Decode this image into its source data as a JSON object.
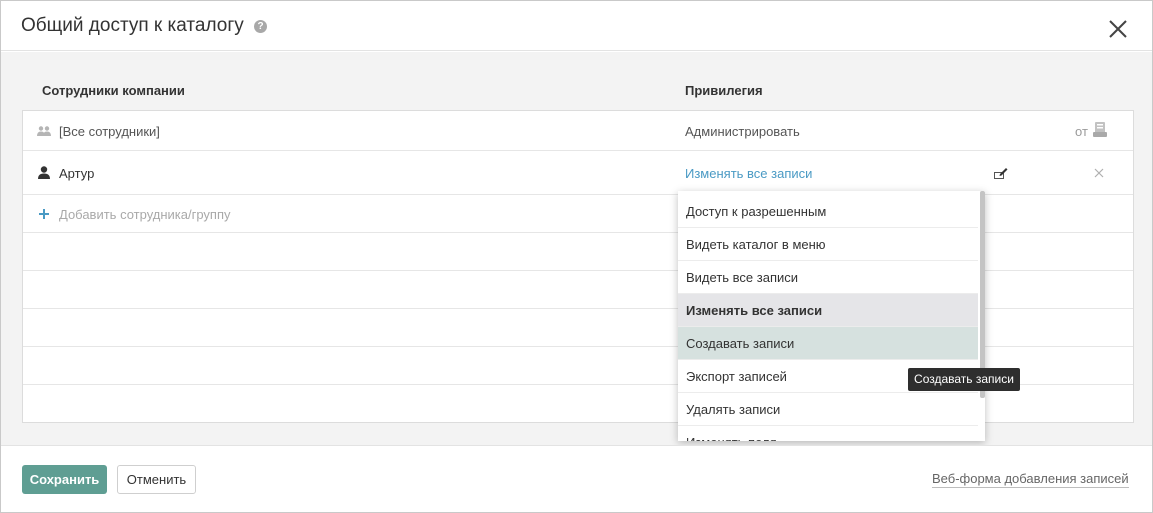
{
  "dialog": {
    "title": "Общий доступ к каталогу",
    "help_icon": "?",
    "close_icon": "close-icon"
  },
  "table": {
    "col_employees": "Сотрудники компании",
    "col_privilege": "Привилегия",
    "rows": [
      {
        "name": "[Все сотрудники]",
        "privilege": "Администрировать",
        "extra": "от",
        "icon": "group-icon"
      },
      {
        "name": "Артур",
        "privilege": "Изменять все записи",
        "icon": "user-icon"
      }
    ],
    "add_label": "Добавить сотрудника/группу"
  },
  "dropdown": {
    "items": [
      "Доступ к разрешенным",
      "Видеть каталог в меню",
      "Видеть все записи",
      "Изменять все записи",
      "Создавать записи",
      "Экспорт записей",
      "Удалять записи",
      "Изменять поля"
    ],
    "selected": "Изменять все записи",
    "hovered": "Создавать записи"
  },
  "tooltip": "Создавать записи",
  "footer": {
    "save": "Сохранить",
    "cancel": "Отменить",
    "webform_link": "Веб-форма добавления записей"
  },
  "colors": {
    "accent": "#5f9e93",
    "link": "#4a9ac4",
    "selected_bg": "#e5e5e8",
    "hover_bg": "#d6e1df"
  }
}
